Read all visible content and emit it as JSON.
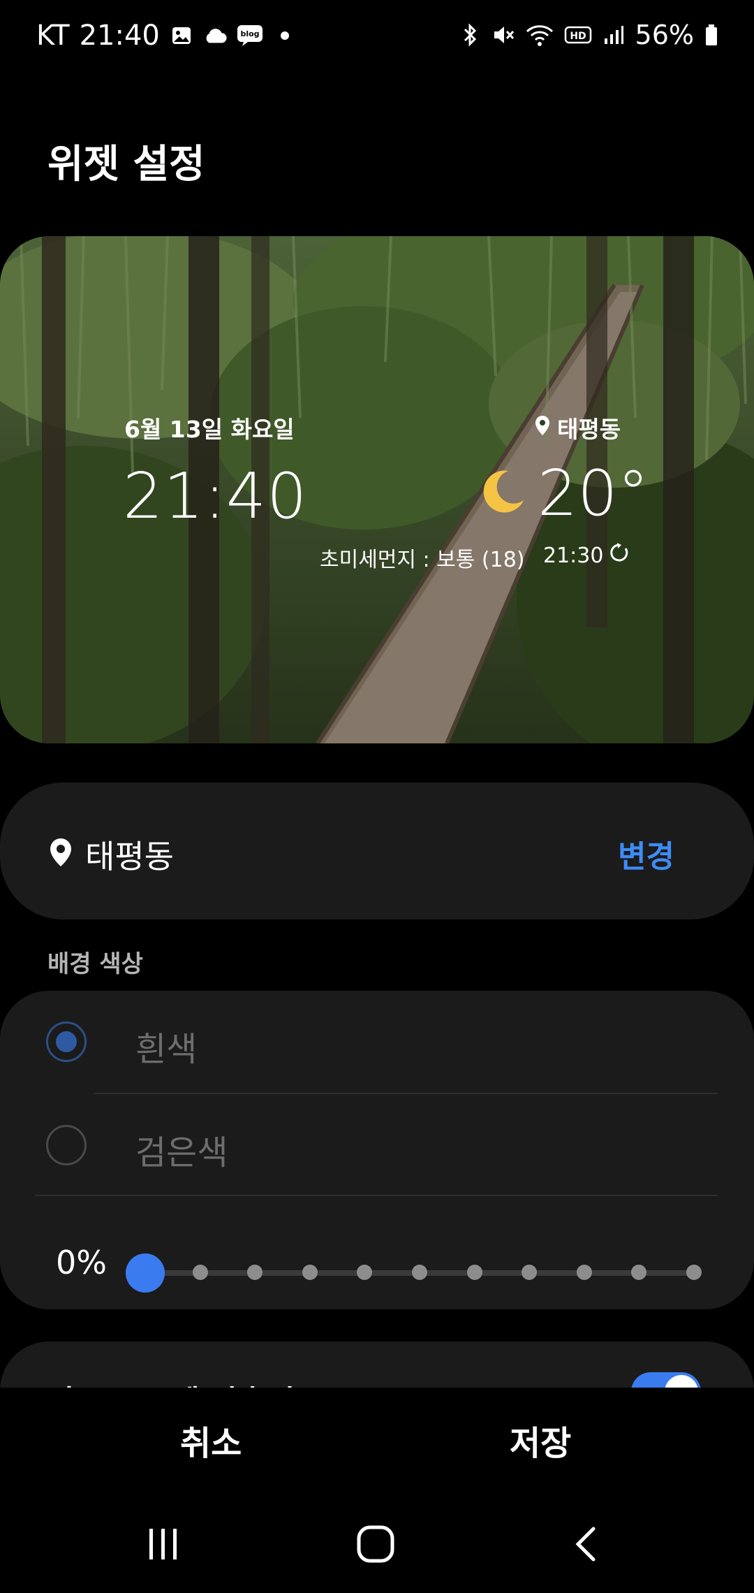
{
  "status_bar": {
    "carrier": "KT",
    "time": "21:40",
    "blog_badge": "blog",
    "battery": "56%",
    "network_badge": "HD"
  },
  "title": "위젯 설정",
  "preview": {
    "date": "6월 13일 화요일",
    "time": "21:40",
    "location": "태평동",
    "temperature": "20°",
    "air_quality": "초미세먼지 : 보통 (18)",
    "updated_time": "21:30"
  },
  "location_card": {
    "name": "태평동",
    "change_label": "변경"
  },
  "background_section": {
    "label": "배경 색상",
    "options": [
      {
        "label": "흰색",
        "selected": true
      },
      {
        "label": "검은색",
        "selected": false
      }
    ],
    "transparency_value": "0%",
    "transparency": 0
  },
  "dark_mode": {
    "label": "다크 모드에 맞추기",
    "enabled": true
  },
  "actions": {
    "cancel_label": "취소",
    "save_label": "저장"
  },
  "colors": {
    "accent": "#3a7cf0",
    "link": "#3e8cf6",
    "card_bg": "#1b1b1b",
    "moon": "#f6c445"
  },
  "icons": [
    "photo-icon",
    "cloud-icon",
    "bluetooth-icon",
    "mute-icon",
    "wifi-icon",
    "signal-icon",
    "battery-icon",
    "location-pin-icon",
    "moon-icon",
    "refresh-icon",
    "recent-apps-icon",
    "home-icon",
    "back-icon"
  ]
}
